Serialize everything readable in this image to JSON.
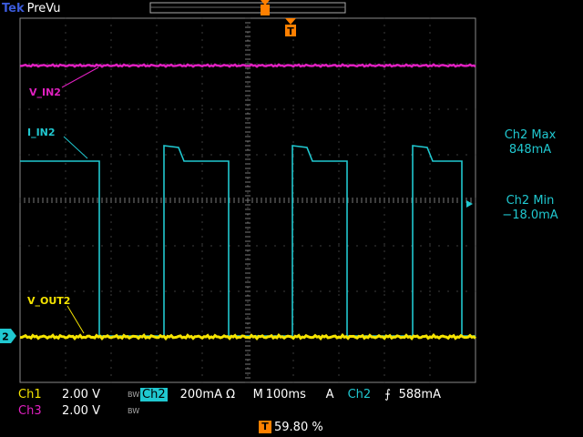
{
  "header": {
    "brand": "Tek",
    "mode": "PreVu"
  },
  "channels": {
    "v_in2": {
      "label": "V_IN2",
      "color": "#e020c0"
    },
    "i_in2": {
      "label": "I_IN2",
      "color": "#20c8d0"
    },
    "v_out2": {
      "label": "V_OUT2",
      "color": "#f5e400"
    }
  },
  "measurements": {
    "max_label": "Ch2 Max",
    "max_value": "848mA",
    "min_label": "Ch2 Min",
    "min_value": "−18.0mA"
  },
  "ground_marker": "2",
  "trigger_marker": "T",
  "settings": {
    "ch1_label": "Ch1",
    "ch1_scale": "2.00 V",
    "ch1_bw": "BW",
    "ch2_label": "Ch2",
    "ch2_scale": "200mA Ω",
    "timebase_label": "M",
    "timebase_value": "100ms",
    "trigger_mode": "A",
    "trigger_source": "Ch2",
    "trigger_level": "588mA",
    "ch3_label": "Ch3",
    "ch3_scale": "2.00 V",
    "ch3_bw": "BW"
  },
  "trigger_position": "59.80 %"
}
